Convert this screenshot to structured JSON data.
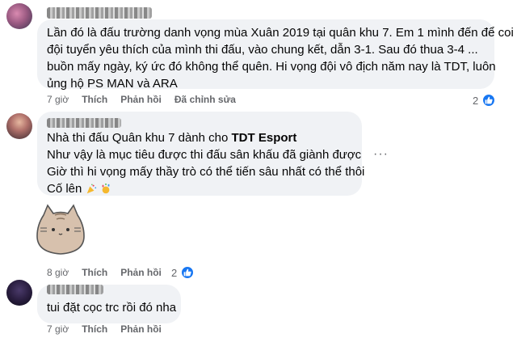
{
  "comments": [
    {
      "author_blurred": true,
      "lines": [
        "Lần đó là đấu trường danh vọng mùa Xuân 2019 tại quân khu 7. Em 1 mình đến để coi",
        "đội tuyển yêu thích của mình thi đấu, vào chung kết, dẫn 3-1. Sau đó thua 3-4 ...",
        "buồn mấy ngày, ký ức đó không thể quên. Hi vọng đội vô địch năm nay là TDT, luôn",
        "ủng hộ PS MAN và ARA"
      ],
      "time": "7 giờ",
      "like_label": "Thích",
      "reply_label": "Phản hồi",
      "edited_label": "Đã chỉnh sửa",
      "reaction_count": "2",
      "reaction_icon": "like-icon"
    },
    {
      "author_blurred": true,
      "line1_prefix": "Nhà thi đấu Quân khu 7 dành cho ",
      "line1_tag": "TDT Esport",
      "lines": [
        "Như vậy là mục tiêu được thi đấu sân khấu đã giành được",
        "Giờ thì hi vọng mấy thầy trò có thể tiến sâu nhất có thể thôi",
        "Cố lên"
      ],
      "emoji_icons": [
        "party-popper-icon",
        "confetti-icon"
      ],
      "sticker": "pusheen-sticker",
      "time": "8 giờ",
      "like_label": "Thích",
      "reply_label": "Phản hồi",
      "reaction_count": "2",
      "reaction_icon": "like-icon"
    },
    {
      "author_blurred": true,
      "lines": [
        "tui đặt cọc trc rồi đó nha"
      ],
      "time": "7 giờ",
      "like_label": "Thích",
      "reply_label": "Phản hồi"
    }
  ],
  "more_options": "···",
  "colors": {
    "bubble": "#f0f2f5",
    "like_blue": "#1877f2",
    "secondary_text": "#65676b"
  }
}
